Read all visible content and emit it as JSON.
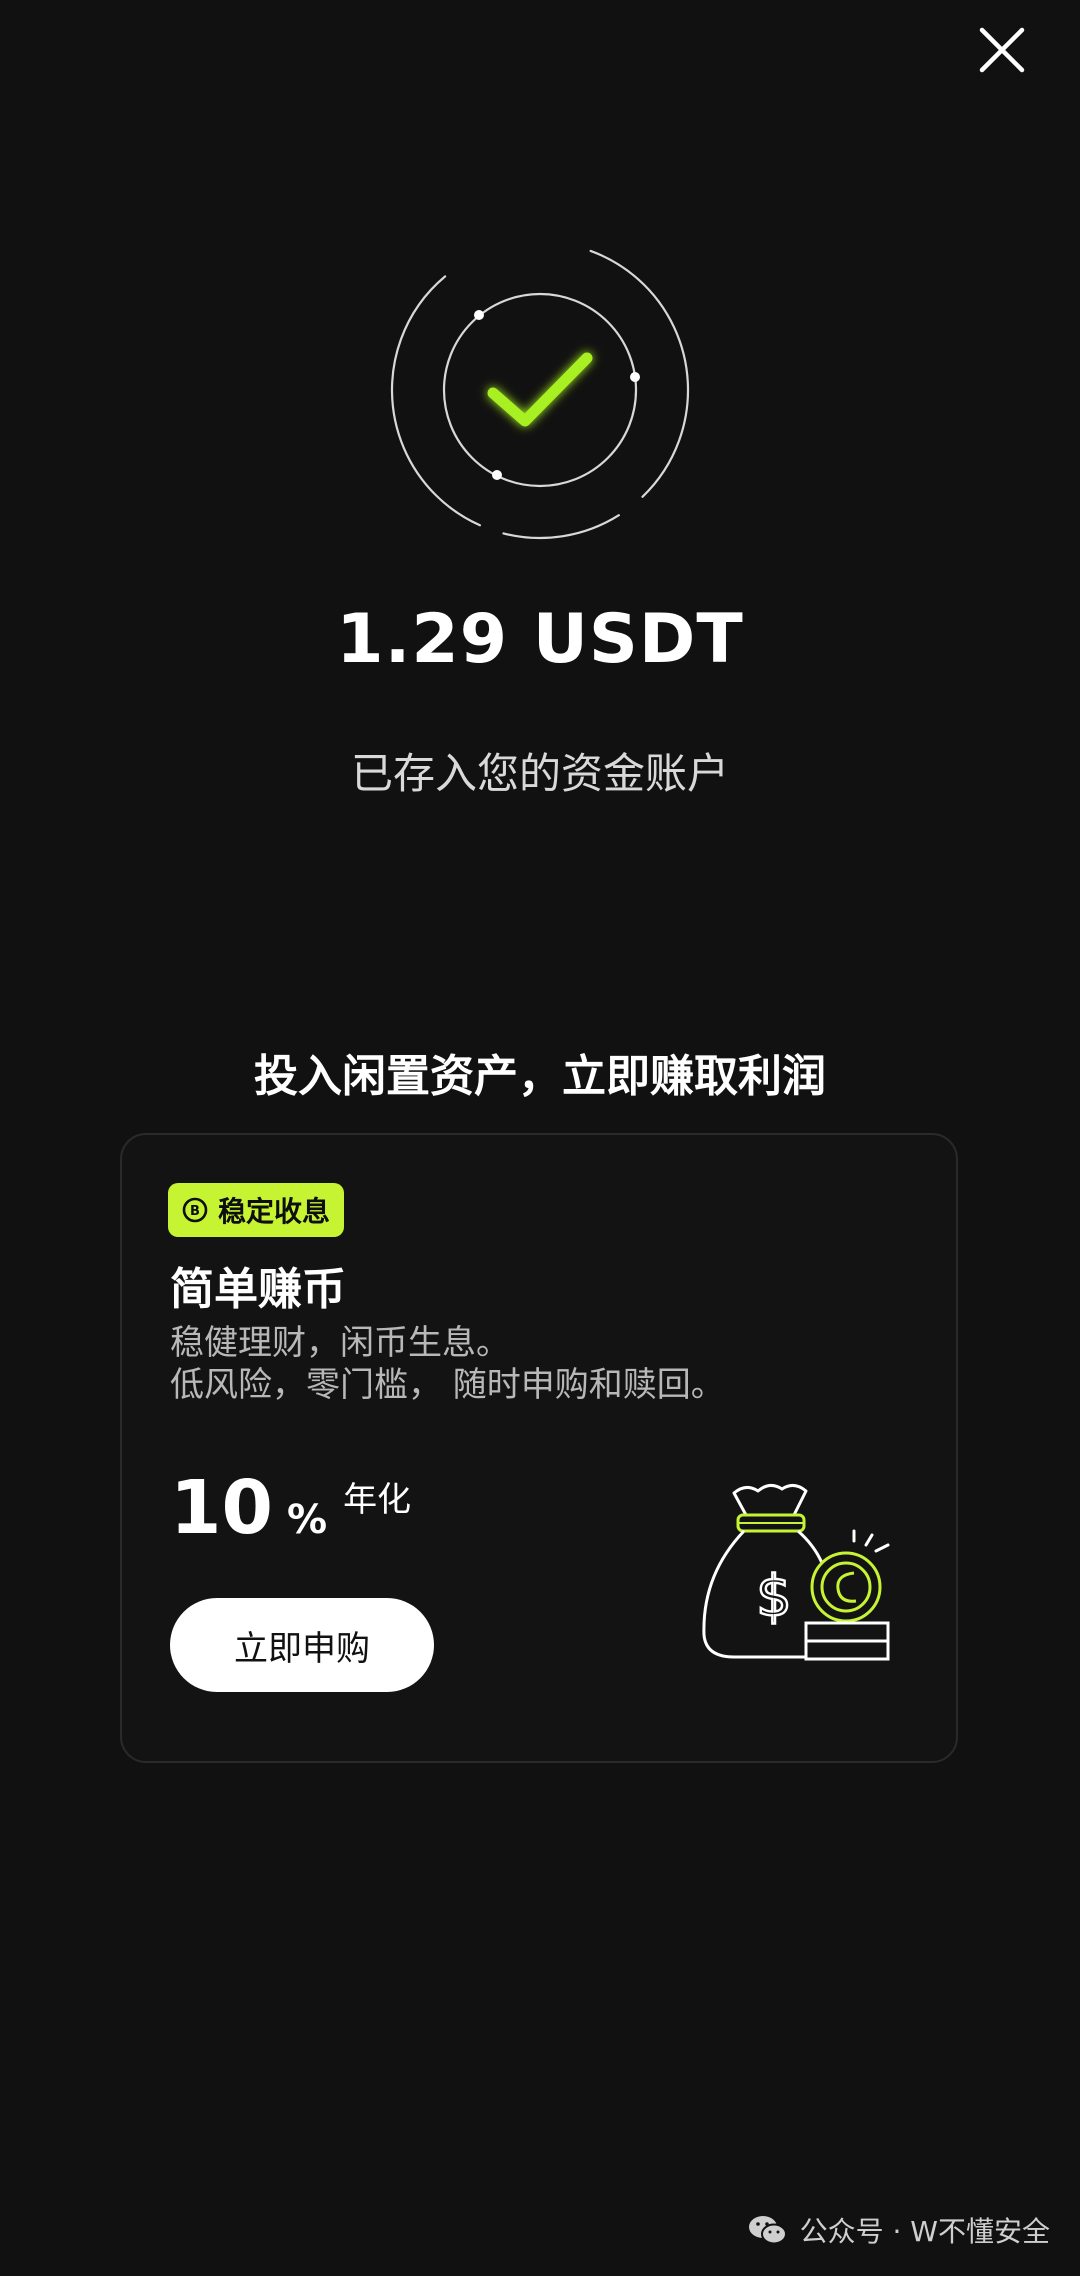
{
  "header": {
    "close_icon": "close-icon"
  },
  "hero": {
    "icon": "success-check-icon",
    "accent_color": "#a8f020"
  },
  "result": {
    "amount": "1.29 USDT",
    "message": "已存入您的资金账户"
  },
  "promo": {
    "title": "投入闲置资产，立即赚取利润",
    "card": {
      "badge_label": "稳定收息",
      "badge_icon": "coin-icon",
      "badge_color": "#c6f432",
      "product_name": "简单赚币",
      "description_line1": "稳健理财，闲币生息。",
      "description_line2": "低风险，零门槛， 随时申购和赎回。",
      "rate_value": "10",
      "rate_unit": "%",
      "rate_label": "年化",
      "cta_label": "立即申购",
      "illustration": "money-bag-icon"
    }
  },
  "watermark": {
    "icon": "wechat-icon",
    "text": "公众号 · W不懂安全"
  }
}
